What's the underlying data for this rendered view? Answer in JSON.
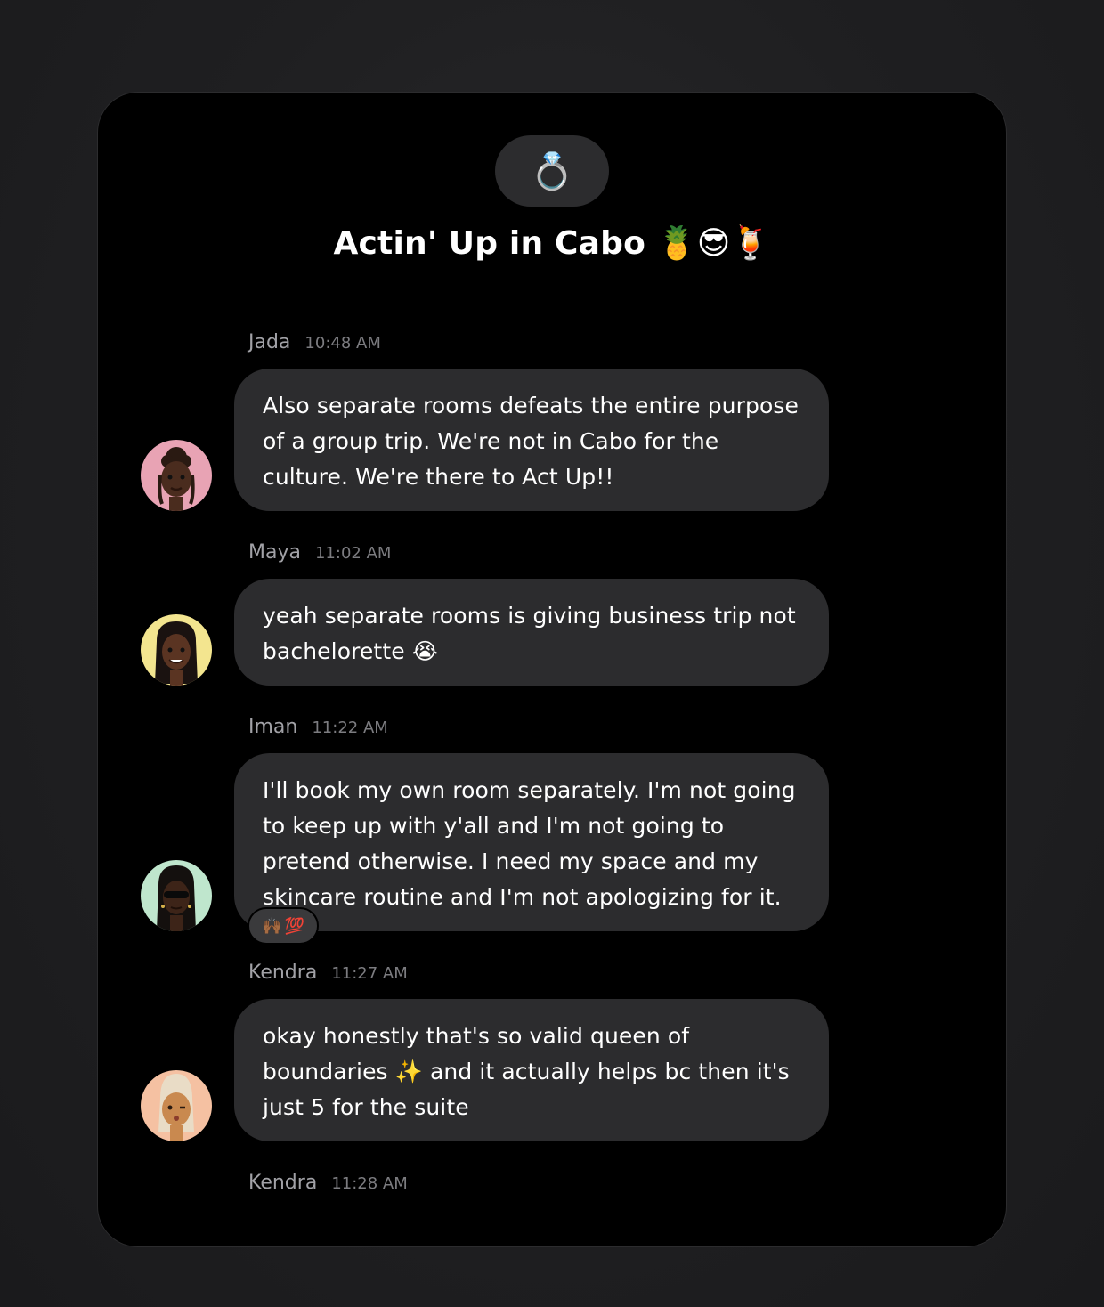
{
  "chat": {
    "group_icon": "💍",
    "title": "Actin' Up in Cabo 🍍😎🍹"
  },
  "messages": [
    {
      "sender": "Jada",
      "time": "10:48 AM",
      "text": "Also separate rooms defeats the entire purpose of a group trip. We're not in Cabo for the culture. We're there to Act Up!!",
      "avatar_color": "#e8a3b4"
    },
    {
      "sender": "Maya",
      "time": "11:02 AM",
      "text": "yeah separate rooms is giving business trip not bachelorette 😭",
      "avatar_color": "#f3e58f"
    },
    {
      "sender": "Iman",
      "time": "11:22 AM",
      "text": "I'll book my own room separately. I'm not going to keep up with y'all and I'm not going to pretend otherwise. I need my space and my skincare routine and I'm not apologizing for it.",
      "avatar_color": "#bfe6cd",
      "reactions": [
        "🙌🏾",
        "💯"
      ]
    },
    {
      "sender": "Kendra",
      "time": "11:27 AM",
      "text": "okay honestly that's so valid queen of boundaries ✨ and it actually helps bc then it's just 5 for the suite",
      "avatar_color": "#f5c1a2"
    },
    {
      "sender": "Kendra",
      "time": "11:28 AM"
    }
  ]
}
